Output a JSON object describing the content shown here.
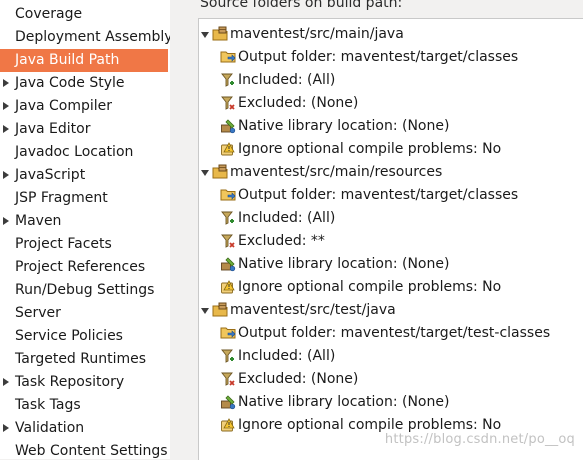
{
  "sidebar": {
    "items": [
      {
        "label": "Coverage",
        "arrow": false,
        "selected": false
      },
      {
        "label": "Deployment Assembly",
        "arrow": false,
        "selected": false
      },
      {
        "label": "Java Build Path",
        "arrow": false,
        "selected": true
      },
      {
        "label": "Java Code Style",
        "arrow": true,
        "selected": false
      },
      {
        "label": "Java Compiler",
        "arrow": true,
        "selected": false
      },
      {
        "label": "Java Editor",
        "arrow": true,
        "selected": false
      },
      {
        "label": "Javadoc Location",
        "arrow": false,
        "selected": false
      },
      {
        "label": "JavaScript",
        "arrow": true,
        "selected": false
      },
      {
        "label": "JSP Fragment",
        "arrow": false,
        "selected": false
      },
      {
        "label": "Maven",
        "arrow": true,
        "selected": false
      },
      {
        "label": "Project Facets",
        "arrow": false,
        "selected": false
      },
      {
        "label": "Project References",
        "arrow": false,
        "selected": false
      },
      {
        "label": "Run/Debug Settings",
        "arrow": false,
        "selected": false
      },
      {
        "label": "Server",
        "arrow": false,
        "selected": false
      },
      {
        "label": "Service Policies",
        "arrow": false,
        "selected": false
      },
      {
        "label": "Targeted Runtimes",
        "arrow": false,
        "selected": false
      },
      {
        "label": "Task Repository",
        "arrow": true,
        "selected": false
      },
      {
        "label": "Task Tags",
        "arrow": false,
        "selected": false
      },
      {
        "label": "Validation",
        "arrow": true,
        "selected": false
      },
      {
        "label": "Web Content Settings",
        "arrow": false,
        "selected": false
      }
    ]
  },
  "main": {
    "source_label": "Source folders on build path:",
    "folders": [
      {
        "name": "maventest/src/main/java",
        "icon": "package-folder-icon",
        "children": [
          {
            "text": "Output folder: maventest/target/classes",
            "icon": "output-folder-icon"
          },
          {
            "text": "Included: (All)",
            "icon": "included-filter-icon"
          },
          {
            "text": "Excluded: (None)",
            "icon": "excluded-filter-icon"
          },
          {
            "text": "Native library location: (None)",
            "icon": "native-library-icon"
          },
          {
            "text": "Ignore optional compile problems: No",
            "icon": "ignore-problems-icon"
          }
        ]
      },
      {
        "name": "maventest/src/main/resources",
        "icon": "package-folder-icon",
        "children": [
          {
            "text": "Output folder: maventest/target/classes",
            "icon": "output-folder-icon"
          },
          {
            "text": "Included: (All)",
            "icon": "included-filter-icon"
          },
          {
            "text": "Excluded: **",
            "icon": "excluded-filter-icon"
          },
          {
            "text": "Native library location: (None)",
            "icon": "native-library-icon"
          },
          {
            "text": "Ignore optional compile problems: No",
            "icon": "ignore-problems-icon"
          }
        ]
      },
      {
        "name": "maventest/src/test/java",
        "icon": "package-folder-icon",
        "children": [
          {
            "text": "Output folder: maventest/target/test-classes",
            "icon": "output-folder-icon"
          },
          {
            "text": "Included: (All)",
            "icon": "included-filter-icon"
          },
          {
            "text": "Excluded: (None)",
            "icon": "excluded-filter-icon"
          },
          {
            "text": "Native library location: (None)",
            "icon": "native-library-icon"
          },
          {
            "text": "Ignore optional compile problems: No",
            "icon": "ignore-problems-icon"
          }
        ]
      }
    ]
  },
  "watermark": "https://blog.csdn.net/po__oq",
  "colors": {
    "selection": "#f07746",
    "folder": "#e8b84a",
    "panel_bg": "#f2f1f0"
  }
}
